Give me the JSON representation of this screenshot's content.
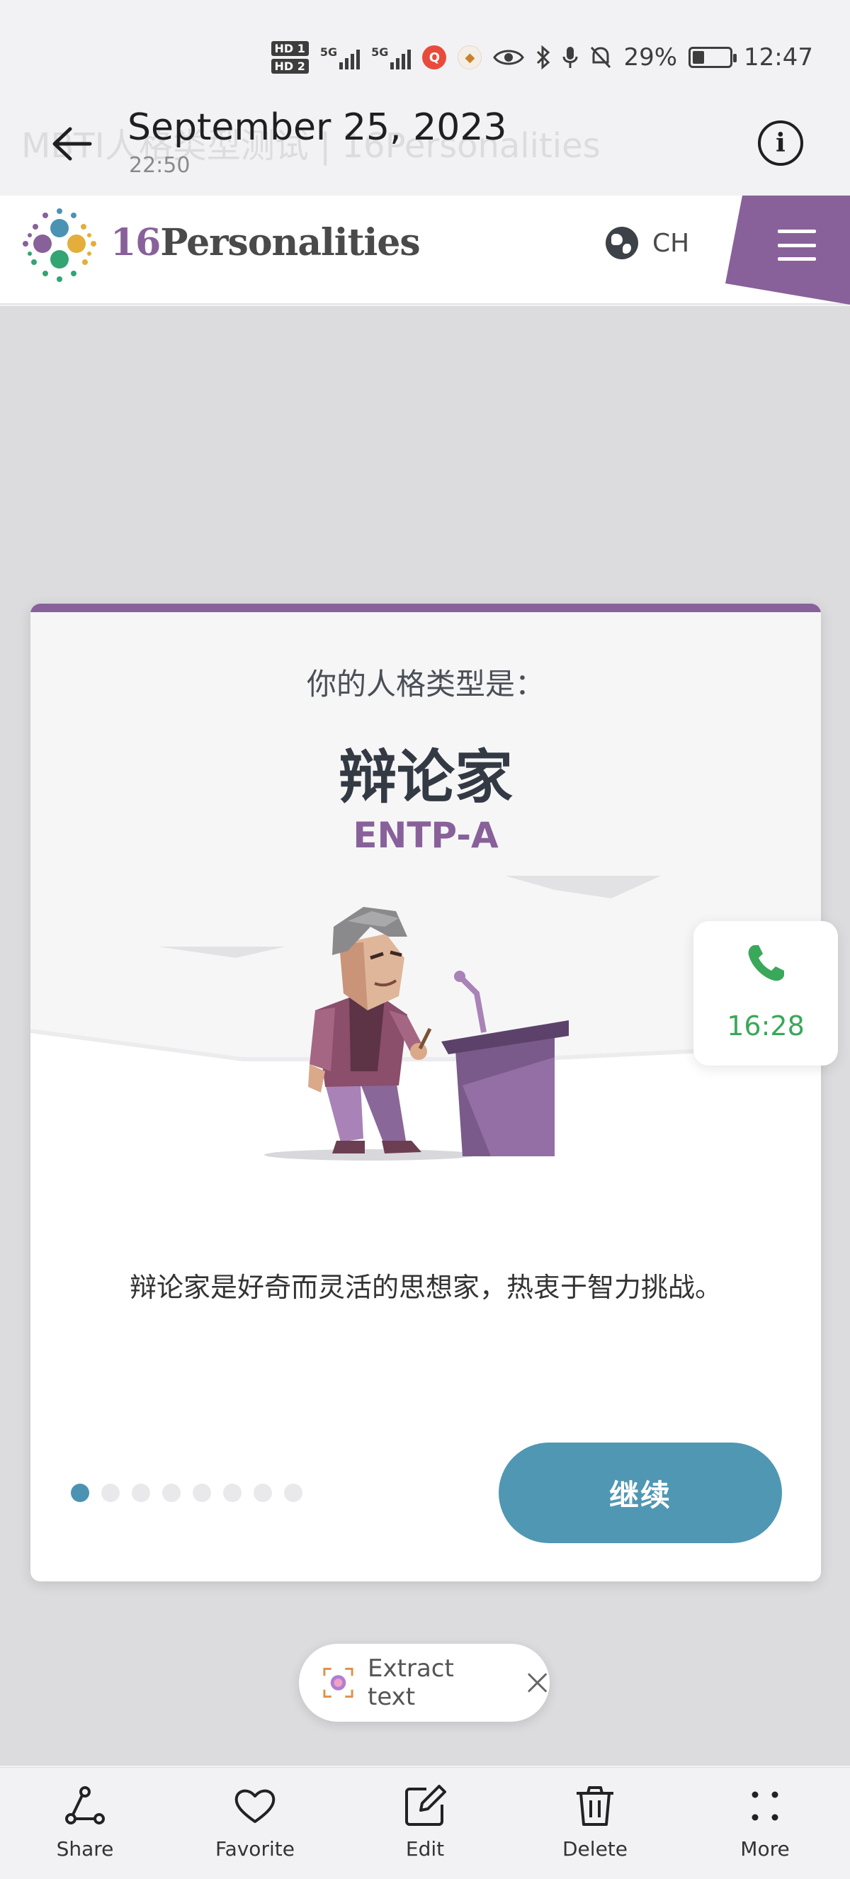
{
  "status_bar": {
    "hd1": "HD 1",
    "hd2": "HD 2",
    "net1": "5G",
    "net2": "5G",
    "battery": "29%",
    "clock": "12:47"
  },
  "gallery_header": {
    "date": "September 25, 2023",
    "time": "22:50",
    "ghost_text": "MBTI人格类型测试 | 16Personalities"
  },
  "site": {
    "brand_number": "16",
    "brand_name": "Personalities",
    "language": "CH",
    "colors": {
      "brand_purple": "#88619a",
      "button_blue": "#5097b3"
    }
  },
  "card": {
    "subtitle": "你的人格类型是：",
    "type_name": "辩论家",
    "type_code": "ENTP-A",
    "description": "辩论家是好奇而灵活的思想家，热衷于智力挑战。",
    "continue_label": "继续",
    "pagination": {
      "current": 1,
      "total": 8
    }
  },
  "floating_call": {
    "time": "16:28"
  },
  "extract": {
    "label": "Extract text"
  },
  "toolbar": {
    "share": "Share",
    "favorite": "Favorite",
    "edit": "Edit",
    "delete": "Delete",
    "more": "More"
  }
}
